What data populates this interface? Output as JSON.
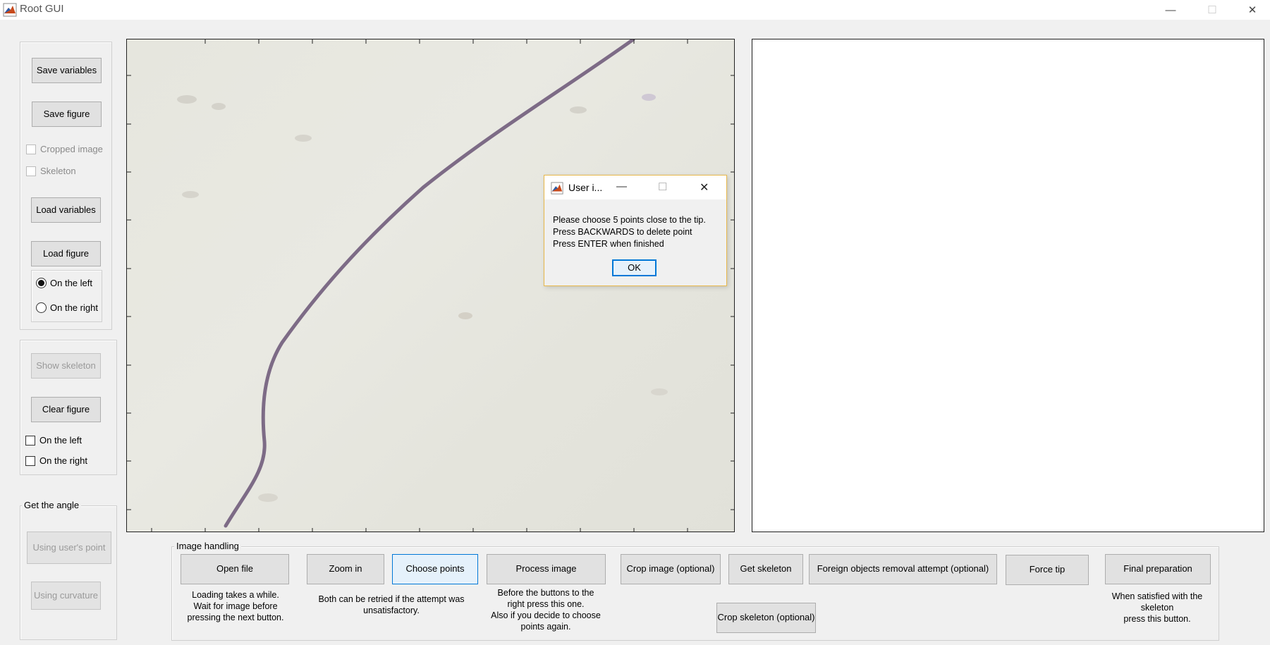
{
  "window": {
    "title": "Root GUI",
    "icon": "matlab-icon",
    "controls": {
      "minimize": "—",
      "maximize": "☐",
      "close": "✕"
    }
  },
  "left_panel": {
    "save_variables": "Save variables",
    "save_figure": "Save figure",
    "cropped_image": "Cropped image",
    "skeleton": "Skeleton",
    "load_variables": "Load variables",
    "load_figure": "Load figure",
    "radio_left": "On the left",
    "radio_right": "On the right",
    "radio_selected": "On the left"
  },
  "skeleton_panel": {
    "show_skeleton": "Show skeleton",
    "clear_figure": "Clear figure",
    "check_left": "On the left",
    "check_right": "On the right"
  },
  "angle_panel": {
    "legend": "Get the angle",
    "using_users_point": "Using user's point",
    "using_curvature": "Using curvature"
  },
  "image_handling": {
    "legend": "Image handling",
    "open_file": "Open file",
    "open_file_note": [
      "Loading takes a while.",
      "Wait for  image before",
      "pressing the next button."
    ],
    "zoom_in": "Zoom in",
    "choose_points": "Choose points",
    "zoom_choose_note": [
      "Both can be retried if the attempt was",
      "unsatisfactory."
    ],
    "process_image": "Process image",
    "process_note": [
      "Before the buttons to the",
      "right press this one.",
      "Also if you decide to choose",
      "points again."
    ],
    "crop_image": "Crop image (optional)",
    "get_skeleton": "Get skeleton",
    "foreign_objects": "Foreign objects removal attempt (optional)",
    "crop_skeleton": "Crop skeleton (optional)",
    "force_tip": "Force tip",
    "final_preparation": "Final preparation",
    "final_note": [
      "When satisfied with the",
      "skeleton",
      "press this button."
    ]
  },
  "dialog": {
    "title": "User i...",
    "message": [
      "Please choose 5 points close to the tip.",
      "Press BACKWARDS to delete point",
      "Press ENTER when finished"
    ],
    "ok": "OK"
  },
  "colors": {
    "root": "#7d6b86",
    "dialog_border": "#e8b84a",
    "focus": "#0078d7"
  }
}
